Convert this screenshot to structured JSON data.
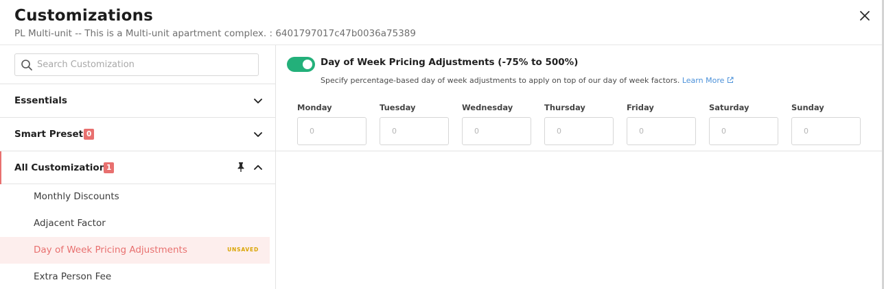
{
  "header": {
    "title": "Customizations",
    "subtitle": "PL Multi-unit -- This is a Multi-unit apartment complex. : 6401797017c47b0036a75389",
    "close_icon": "close-icon"
  },
  "sidebar": {
    "search": {
      "placeholder": "Search Customization",
      "value": ""
    },
    "sections": [
      {
        "label": "Essentials",
        "badge": "",
        "expanded": false
      },
      {
        "label": "Smart Presets",
        "badge": "0",
        "expanded": false
      },
      {
        "label": "All Customizations",
        "badge": "1",
        "expanded": true,
        "pinned": true
      }
    ],
    "items": [
      {
        "label": "Monthly Discounts",
        "status": ""
      },
      {
        "label": "Adjacent Factor",
        "status": ""
      },
      {
        "label": "Day of Week Pricing Adjustments",
        "status": "UNSAVED",
        "selected": true
      },
      {
        "label": "Extra Person Fee",
        "status": ""
      }
    ]
  },
  "main": {
    "toggle_on": true,
    "title": "Day of Week Pricing Adjustments (-75% to 500%)",
    "description": "Specify percentage-based day of week adjustments to apply on top of our day of week factors.",
    "learn_more": "Learn More",
    "days": [
      {
        "label": "Monday",
        "placeholder": "0"
      },
      {
        "label": "Tuesday",
        "placeholder": "0"
      },
      {
        "label": "Wednesday",
        "placeholder": "0"
      },
      {
        "label": "Thursday",
        "placeholder": "0"
      },
      {
        "label": "Friday",
        "placeholder": "0"
      },
      {
        "label": "Saturday",
        "placeholder": "0"
      },
      {
        "label": "Sunday",
        "placeholder": "0"
      }
    ]
  },
  "colors": {
    "accent": "#e8706f",
    "toggle_on": "#23b07a",
    "link": "#4a90d9",
    "unsaved": "#d9a400"
  }
}
